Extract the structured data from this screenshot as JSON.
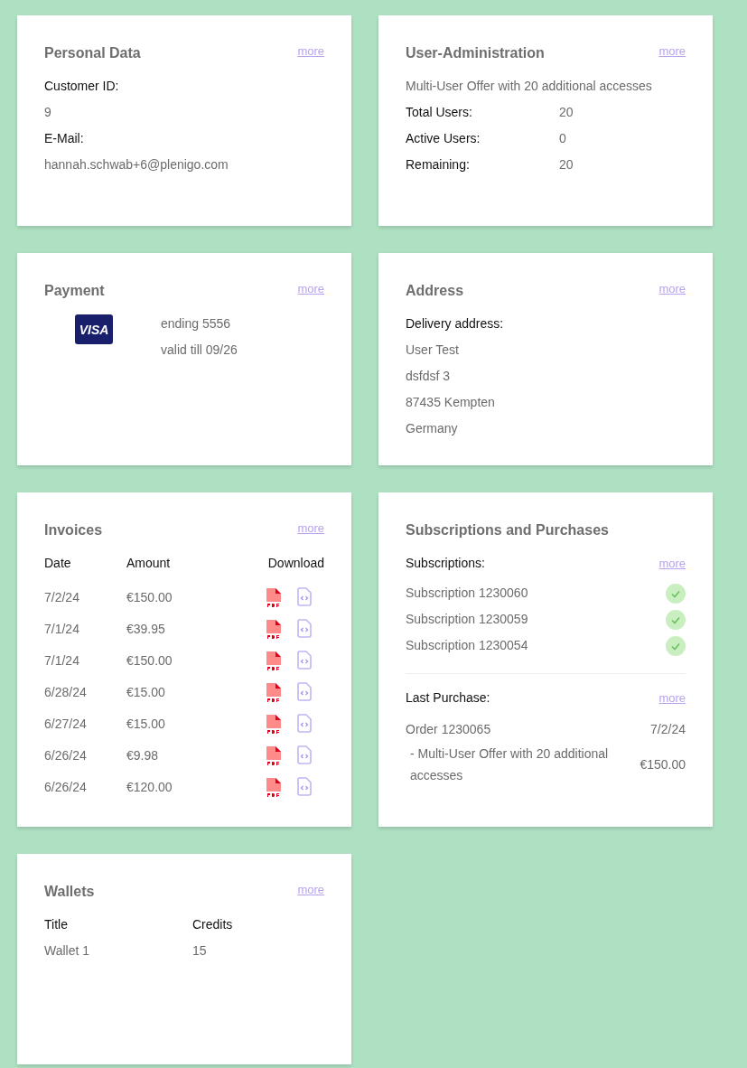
{
  "personal_data": {
    "title": "Personal Data",
    "more": "more",
    "fields": [
      {
        "label": "Customer ID:",
        "value": "9"
      },
      {
        "label": "E-Mail:",
        "value": "hannah.schwab+6@plenigo.com"
      }
    ]
  },
  "user_administration": {
    "title": "User-Administration",
    "more": "more",
    "offer": "Multi-User Offer with 20 additional accesses",
    "stats": [
      {
        "label": "Total Users:",
        "value": "20"
      },
      {
        "label": "Active Users:",
        "value": "0"
      },
      {
        "label": "Remaining:",
        "value": "20"
      }
    ]
  },
  "payment": {
    "title": "Payment",
    "more": "more",
    "card_logo": "VISA",
    "ending": "ending 5556",
    "valid": "valid till 09/26"
  },
  "address": {
    "title": "Address",
    "more": "more",
    "label": "Delivery address:",
    "lines": [
      "User Test",
      "dsfdsf 3",
      "87435 Kempten",
      "Germany"
    ]
  },
  "invoices": {
    "title": "Invoices",
    "more": "more",
    "columns": [
      "Date",
      "Amount",
      "Download"
    ],
    "rows": [
      {
        "date": "7/2/24",
        "amount": "€150.00"
      },
      {
        "date": "7/1/24",
        "amount": "€39.95"
      },
      {
        "date": "7/1/24",
        "amount": "€150.00"
      },
      {
        "date": "6/28/24",
        "amount": "€15.00"
      },
      {
        "date": "6/27/24",
        "amount": "€15.00"
      },
      {
        "date": "6/26/24",
        "amount": "€9.98"
      },
      {
        "date": "6/26/24",
        "amount": "€120.00"
      }
    ]
  },
  "subscriptions_and_purchases": {
    "title": "Subscriptions and Purchases",
    "subscriptions_label": "Subscriptions:",
    "subscriptions_more": "more",
    "subscriptions": [
      {
        "name": "Subscription 1230060",
        "active": true
      },
      {
        "name": "Subscription 1230059",
        "active": true
      },
      {
        "name": "Subscription 1230054",
        "active": true
      }
    ],
    "last_purchase_label": "Last Purchase:",
    "last_purchase_more": "more",
    "order": {
      "name": "Order 1230065",
      "date": "7/2/24"
    },
    "order_item": {
      "text": "- Multi-User Offer with 20 additional accesses",
      "price": "€150.00"
    }
  },
  "wallets": {
    "title": "Wallets",
    "more": "more",
    "columns": [
      "Title",
      "Credits"
    ],
    "rows": [
      {
        "title": "Wallet 1",
        "credits": "15"
      }
    ]
  }
}
